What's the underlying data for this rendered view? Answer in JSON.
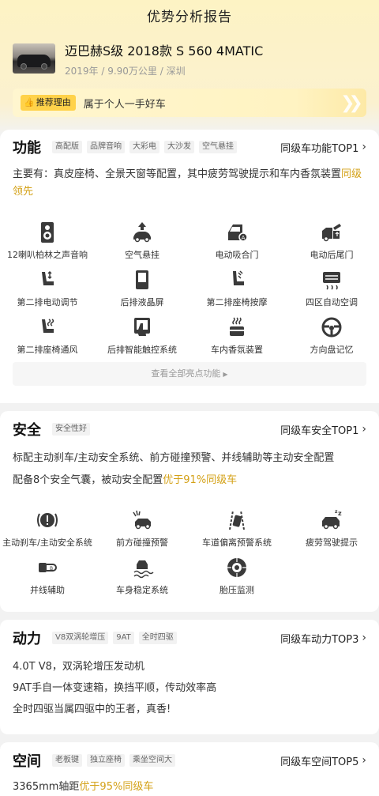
{
  "nav": {
    "title": "优势分析报告"
  },
  "car": {
    "name": "迈巴赫S级 2018款 S 560 4MATIC",
    "meta": "2019年 / 9.90万公里 / 深圳"
  },
  "reason": {
    "badge": "推荐理由",
    "text": "属于个人一手好车"
  },
  "sections": {
    "function": {
      "title": "功能",
      "tags": [
        "高配版",
        "品牌音响",
        "大彩电",
        "大沙发",
        "空气悬挂"
      ],
      "rank": "同级车功能TOP1",
      "desc_main": "主要有：真皮座椅、全景天窗等配置，其中疲劳驾驶提示和车内香氛装置",
      "desc_hl": "同级领先",
      "features": [
        {
          "label": "12喇叭柏林之声音响",
          "icon": "speaker-icon"
        },
        {
          "label": "空气悬挂",
          "icon": "air-suspension-icon"
        },
        {
          "label": "电动吸合门",
          "icon": "soft-close-door-icon"
        },
        {
          "label": "电动后尾门",
          "icon": "power-tailgate-icon"
        },
        {
          "label": "第二排电动调节",
          "icon": "power-seat-icon"
        },
        {
          "label": "后排液晶屏",
          "icon": "rear-screen-icon"
        },
        {
          "label": "第二排座椅按摩",
          "icon": "seat-massage-icon"
        },
        {
          "label": "四区自动空调",
          "icon": "climate-control-icon"
        },
        {
          "label": "第二排座椅通风",
          "icon": "seat-ventilation-icon"
        },
        {
          "label": "后排智能触控系统",
          "icon": "touch-control-icon"
        },
        {
          "label": "车内香氛装置",
          "icon": "fragrance-icon"
        },
        {
          "label": "方向盘记忆",
          "icon": "steering-memory-icon"
        }
      ],
      "more": "查看全部亮点功能"
    },
    "safety": {
      "title": "安全",
      "tags": [
        "安全性好"
      ],
      "rank": "同级车安全TOP1",
      "line1": "标配主动刹车/主动安全系统、前方碰撞预警、并线辅助等主动安全配置",
      "line2_main": "配备8个安全气囊，被动安全配置",
      "line2_hl": "优于91%同级车",
      "features": [
        {
          "label": "主动刹车/主动安全系统",
          "icon": "active-brake-icon"
        },
        {
          "label": "前方碰撞预警",
          "icon": "collision-warning-icon"
        },
        {
          "label": "车道偏离预警系统",
          "icon": "lane-departure-icon"
        },
        {
          "label": "疲劳驾驶提示",
          "icon": "fatigue-alert-icon"
        },
        {
          "label": "并线辅助",
          "icon": "blind-spot-icon"
        },
        {
          "label": "车身稳定系统",
          "icon": "stability-control-icon"
        },
        {
          "label": "胎压监测",
          "icon": "tire-pressure-icon"
        }
      ]
    },
    "power": {
      "title": "动力",
      "tags": [
        "V8双涡轮增压",
        "9AT",
        "全时四驱"
      ],
      "rank": "同级车动力TOP3",
      "lines": [
        "4.0T V8，双涡轮增压发动机",
        "9AT手自一体变速箱，换挡平顺，传动效率高",
        "全时四驱当属四驱中的王者，真香!"
      ]
    },
    "space": {
      "title": "空间",
      "tags": [
        "老板键",
        "独立座椅",
        "乘坐空间大"
      ],
      "rank": "同级车空间TOP5",
      "desc_main": "3365mm轴距",
      "desc_hl": "优于95%同级车"
    }
  }
}
